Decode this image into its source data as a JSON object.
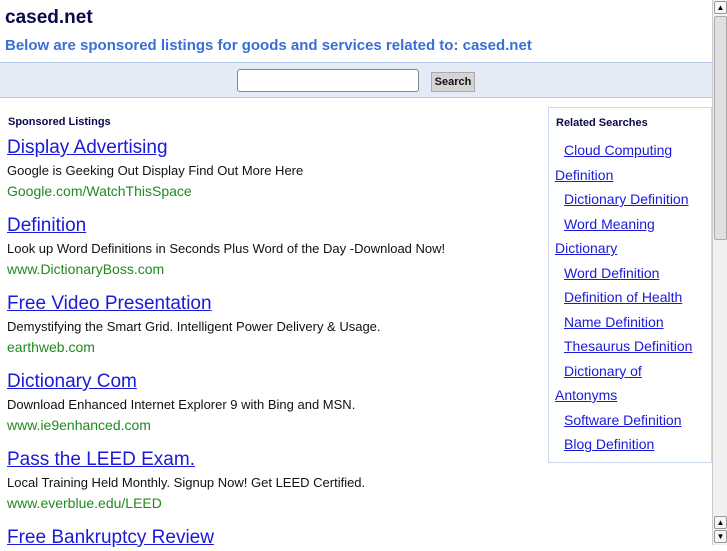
{
  "header": {
    "title": "cased.net",
    "subtitle": "Below are sponsored listings for goods and services related to: cased.net"
  },
  "search": {
    "value": "",
    "button": "Search"
  },
  "sponsored": {
    "heading": "Sponsored Listings",
    "listings": [
      {
        "title": "Display Advertising",
        "desc": "Google is Geeking Out Display Find Out More Here",
        "url": "Google.com/WatchThisSpace"
      },
      {
        "title": "Definition",
        "desc": "Look up Word Definitions in Seconds Plus Word of the Day -Download Now!",
        "url": "www.DictionaryBoss.com"
      },
      {
        "title": "Free Video Presentation",
        "desc": "Demystifying the Smart Grid. Intelligent Power Delivery & Usage.",
        "url": "earthweb.com"
      },
      {
        "title": "Dictionary Com",
        "desc": "Download Enhanced Internet Explorer 9 with Bing and MSN.",
        "url": "www.ie9enhanced.com"
      },
      {
        "title": "Pass the LEED Exam.",
        "desc": "Local Training Held Monthly. Signup Now! Get LEED Certified.",
        "url": "www.everblue.edu/LEED"
      },
      {
        "title": "Free Bankruptcy Review",
        "desc": "",
        "url": ""
      }
    ]
  },
  "related": {
    "heading": "Related Searches",
    "items": [
      "Cloud Computing Definition",
      "Dictionary Definition",
      "Word Meaning Dictionary",
      "Word Definition",
      "Definition of Health",
      "Name Definition",
      "Thesaurus Definition",
      "Dictionary of Antonyms",
      "Software Definition",
      "Blog Definition"
    ]
  }
}
